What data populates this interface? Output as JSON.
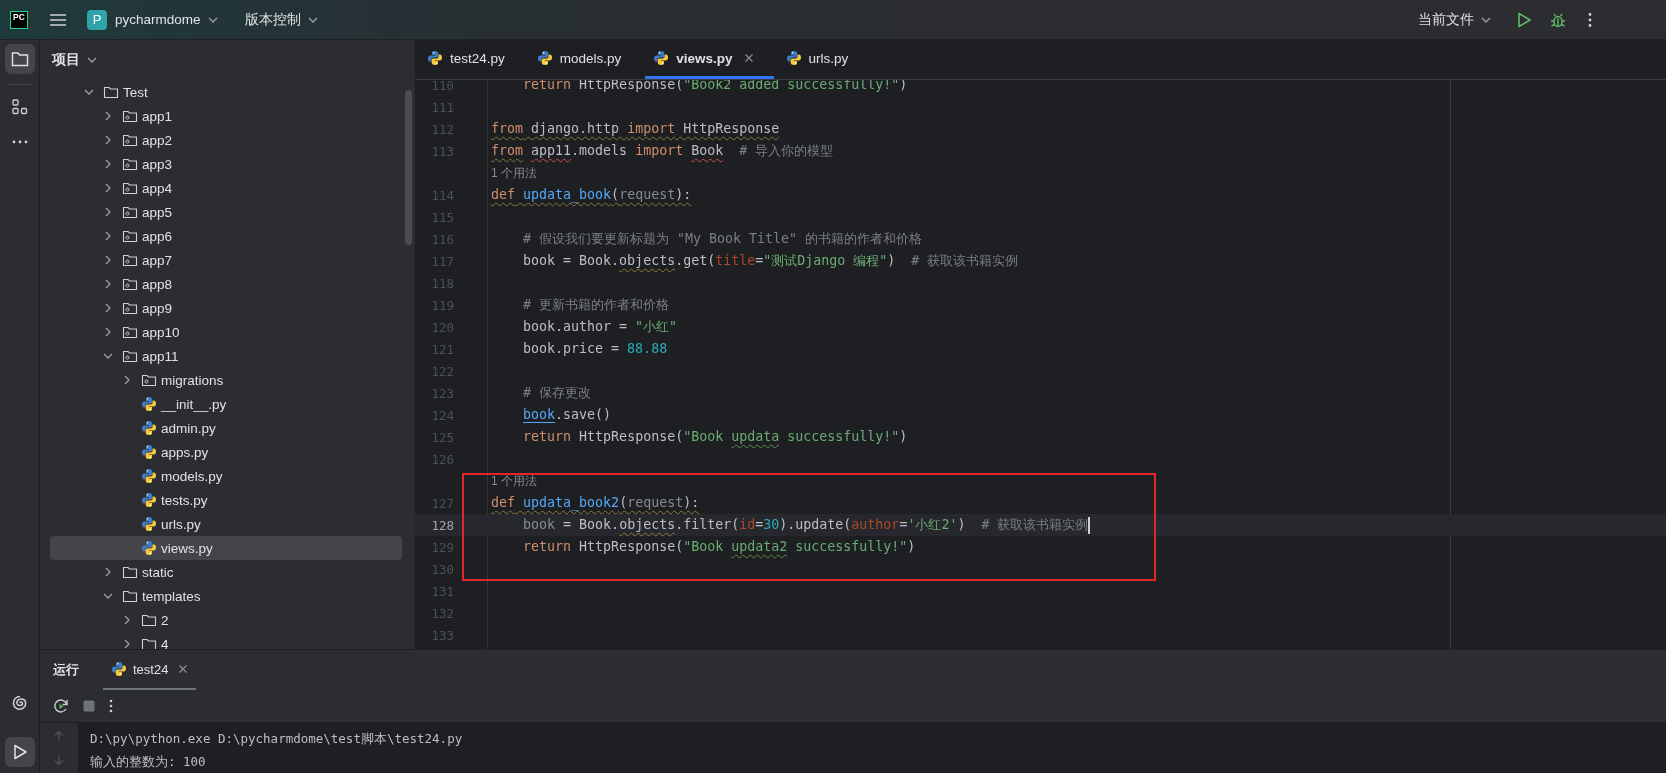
{
  "toolbar": {
    "logo": "PC",
    "project_initial": "P",
    "project": "pycharmdome",
    "vcs": "版本控制",
    "run_config": "当前文件"
  },
  "project_panel": {
    "title": "项目",
    "tree": [
      {
        "label": "Test",
        "kind": "folder",
        "expanded": true,
        "selected": false,
        "children": [
          {
            "label": "app1",
            "kind": "package",
            "expanded": false,
            "selected": false
          },
          {
            "label": "app2",
            "kind": "package",
            "expanded": false,
            "selected": false
          },
          {
            "label": "app3",
            "kind": "package",
            "expanded": false,
            "selected": false
          },
          {
            "label": "app4",
            "kind": "package",
            "expanded": false,
            "selected": false
          },
          {
            "label": "app5",
            "kind": "package",
            "expanded": false,
            "selected": false
          },
          {
            "label": "app6",
            "kind": "package",
            "expanded": false,
            "selected": false
          },
          {
            "label": "app7",
            "kind": "package",
            "expanded": false,
            "selected": false
          },
          {
            "label": "app8",
            "kind": "package",
            "expanded": false,
            "selected": false
          },
          {
            "label": "app9",
            "kind": "package",
            "expanded": false,
            "selected": false
          },
          {
            "label": "app10",
            "kind": "package",
            "expanded": false,
            "selected": false
          },
          {
            "label": "app11",
            "kind": "package",
            "expanded": true,
            "selected": false,
            "children": [
              {
                "label": "migrations",
                "kind": "package",
                "expanded": false,
                "selected": false
              },
              {
                "label": "__init__.py",
                "kind": "python",
                "selected": false
              },
              {
                "label": "admin.py",
                "kind": "python",
                "selected": false
              },
              {
                "label": "apps.py",
                "kind": "python",
                "selected": false
              },
              {
                "label": "models.py",
                "kind": "python",
                "selected": false
              },
              {
                "label": "tests.py",
                "kind": "python",
                "selected": false
              },
              {
                "label": "urls.py",
                "kind": "python",
                "selected": false
              },
              {
                "label": "views.py",
                "kind": "python",
                "selected": true
              }
            ]
          },
          {
            "label": "static",
            "kind": "folder",
            "expanded": false,
            "selected": false
          },
          {
            "label": "templates",
            "kind": "folder",
            "expanded": true,
            "selected": false,
            "children": [
              {
                "label": "2",
                "kind": "folder",
                "expanded": false,
                "selected": false
              },
              {
                "label": "4",
                "kind": "folder",
                "expanded": false,
                "selected": false
              }
            ]
          }
        ]
      }
    ]
  },
  "editor": {
    "tabs": [
      {
        "label": "test24.py",
        "selected": false
      },
      {
        "label": "models.py",
        "selected": false
      },
      {
        "label": "views.py",
        "selected": true
      },
      {
        "label": "urls.py",
        "selected": false
      }
    ],
    "lines": [
      {
        "kind": "code",
        "number": "110",
        "tokens": [
          {
            "text": "    return",
            "kind": "keyword"
          },
          {
            "text": " HttpResponse("
          },
          {
            "text": "\"Book2 added successfully!\"",
            "kind": "string"
          },
          {
            "text": ")"
          }
        ]
      },
      {
        "kind": "code",
        "number": "111"
      },
      {
        "kind": "code",
        "number": "112",
        "warning": true,
        "tokens": [
          {
            "text": "from",
            "kind": "keyword"
          },
          {
            "text": " django.http "
          },
          {
            "text": "import",
            "kind": "keyword"
          },
          {
            "text": " HttpResponse"
          }
        ]
      },
      {
        "kind": "code",
        "number": "113",
        "tokens": [
          {
            "text": "from",
            "kind": "keyword",
            "warning": true
          },
          {
            "text": " app11",
            "error": true
          },
          {
            "text": ".models "
          },
          {
            "text": "import",
            "kind": "keyword"
          },
          {
            "text": " Book",
            "error": true
          },
          {
            "text": "  # 导入你的模型",
            "kind": "comment"
          }
        ]
      },
      {
        "kind": "hint",
        "text": "1 个用法"
      },
      {
        "kind": "code",
        "number": "114",
        "warning": true,
        "tokens": [
          {
            "text": "def",
            "kind": "keyword"
          },
          {
            "text": " updata_book",
            "kind": "function"
          },
          {
            "text": "("
          },
          {
            "text": "request",
            "kind": "unused"
          },
          {
            "text": "):"
          }
        ]
      },
      {
        "kind": "code",
        "number": "115"
      },
      {
        "kind": "code",
        "number": "116",
        "tokens": [
          {
            "text": "    # 假设我们要更新标题为 \"My Book Title\" 的书籍的作者和价格",
            "kind": "comment"
          }
        ]
      },
      {
        "kind": "code",
        "number": "117",
        "tokens": [
          {
            "text": "    book = Book."
          },
          {
            "text": "objects",
            "warning": true
          },
          {
            "text": ".get("
          },
          {
            "text": "title",
            "kind": "kwarg"
          },
          {
            "text": "="
          },
          {
            "text": "\"测试Django 编程\"",
            "kind": "string"
          },
          {
            "text": ")"
          },
          {
            "text": "  # 获取该书籍实例",
            "kind": "comment"
          }
        ]
      },
      {
        "kind": "code",
        "number": "118"
      },
      {
        "kind": "code",
        "number": "119",
        "tokens": [
          {
            "text": "    # 更新书籍的作者和价格",
            "kind": "comment"
          }
        ]
      },
      {
        "kind": "code",
        "number": "120",
        "tokens": [
          {
            "text": "    book.author = "
          },
          {
            "text": "\"小红\"",
            "kind": "string"
          }
        ]
      },
      {
        "kind": "code",
        "number": "121",
        "tokens": [
          {
            "text": "    book.price = "
          },
          {
            "text": "88.88",
            "kind": "number"
          }
        ]
      },
      {
        "kind": "code",
        "number": "122"
      },
      {
        "kind": "code",
        "number": "123",
        "tokens": [
          {
            "text": "    # 保存更改",
            "kind": "comment"
          }
        ]
      },
      {
        "kind": "code",
        "number": "124",
        "tokens": [
          {
            "text": "    book",
            "kind": "link",
            "underlined": true
          },
          {
            "text": ".save()"
          }
        ]
      },
      {
        "kind": "code",
        "number": "125",
        "tokens": [
          {
            "text": "    return",
            "kind": "keyword"
          },
          {
            "text": " HttpResponse("
          },
          {
            "text": "\"Book ",
            "kind": "string"
          },
          {
            "text": "updata",
            "kind": "string",
            "typo": true
          },
          {
            "text": " successfully!\"",
            "kind": "string"
          },
          {
            "text": ")"
          }
        ]
      },
      {
        "kind": "code",
        "number": "126"
      },
      {
        "kind": "hint",
        "text": "1 个用法",
        "boxed": true
      },
      {
        "kind": "code",
        "number": "127",
        "boxed": true,
        "warning": true,
        "tokens": [
          {
            "text": "def",
            "kind": "keyword"
          },
          {
            "text": " updata_book2",
            "kind": "function"
          },
          {
            "text": "("
          },
          {
            "text": "request",
            "kind": "unused"
          },
          {
            "text": "):"
          }
        ]
      },
      {
        "kind": "code",
        "number": "128",
        "boxed": true,
        "current": true,
        "tokens": [
          {
            "text": "    book",
            "kind": "unused"
          },
          {
            "text": " = Book."
          },
          {
            "text": "objects",
            "warning": true
          },
          {
            "text": ".filter("
          },
          {
            "text": "id",
            "kind": "kwarg"
          },
          {
            "text": "="
          },
          {
            "text": "30",
            "kind": "number"
          },
          {
            "text": ").update("
          },
          {
            "text": "author",
            "kind": "kwarg"
          },
          {
            "text": "="
          },
          {
            "text": "'小红2'",
            "kind": "string"
          },
          {
            "text": ")"
          },
          {
            "text": "  # 获取该书籍实例",
            "kind": "comment"
          }
        ]
      },
      {
        "kind": "code",
        "number": "129",
        "boxed": true,
        "tokens": [
          {
            "text": "    return",
            "kind": "keyword"
          },
          {
            "text": " HttpResponse("
          },
          {
            "text": "\"Book ",
            "kind": "string"
          },
          {
            "text": "updata2",
            "kind": "string",
            "typo": true
          },
          {
            "text": " successfully!\"",
            "kind": "string"
          },
          {
            "text": ")"
          }
        ]
      },
      {
        "kind": "code",
        "number": "130",
        "boxed": true
      },
      {
        "kind": "code",
        "number": "131"
      },
      {
        "kind": "code",
        "number": "132"
      },
      {
        "kind": "code",
        "number": "133"
      }
    ]
  },
  "run_panel": {
    "title": "运行",
    "tabs": [
      {
        "label": "test24",
        "selected": true
      }
    ],
    "output": [
      "D:\\py\\python.exe D:\\pycharmdome\\test脚本\\test24.py",
      "输入的整数为: 100"
    ]
  }
}
